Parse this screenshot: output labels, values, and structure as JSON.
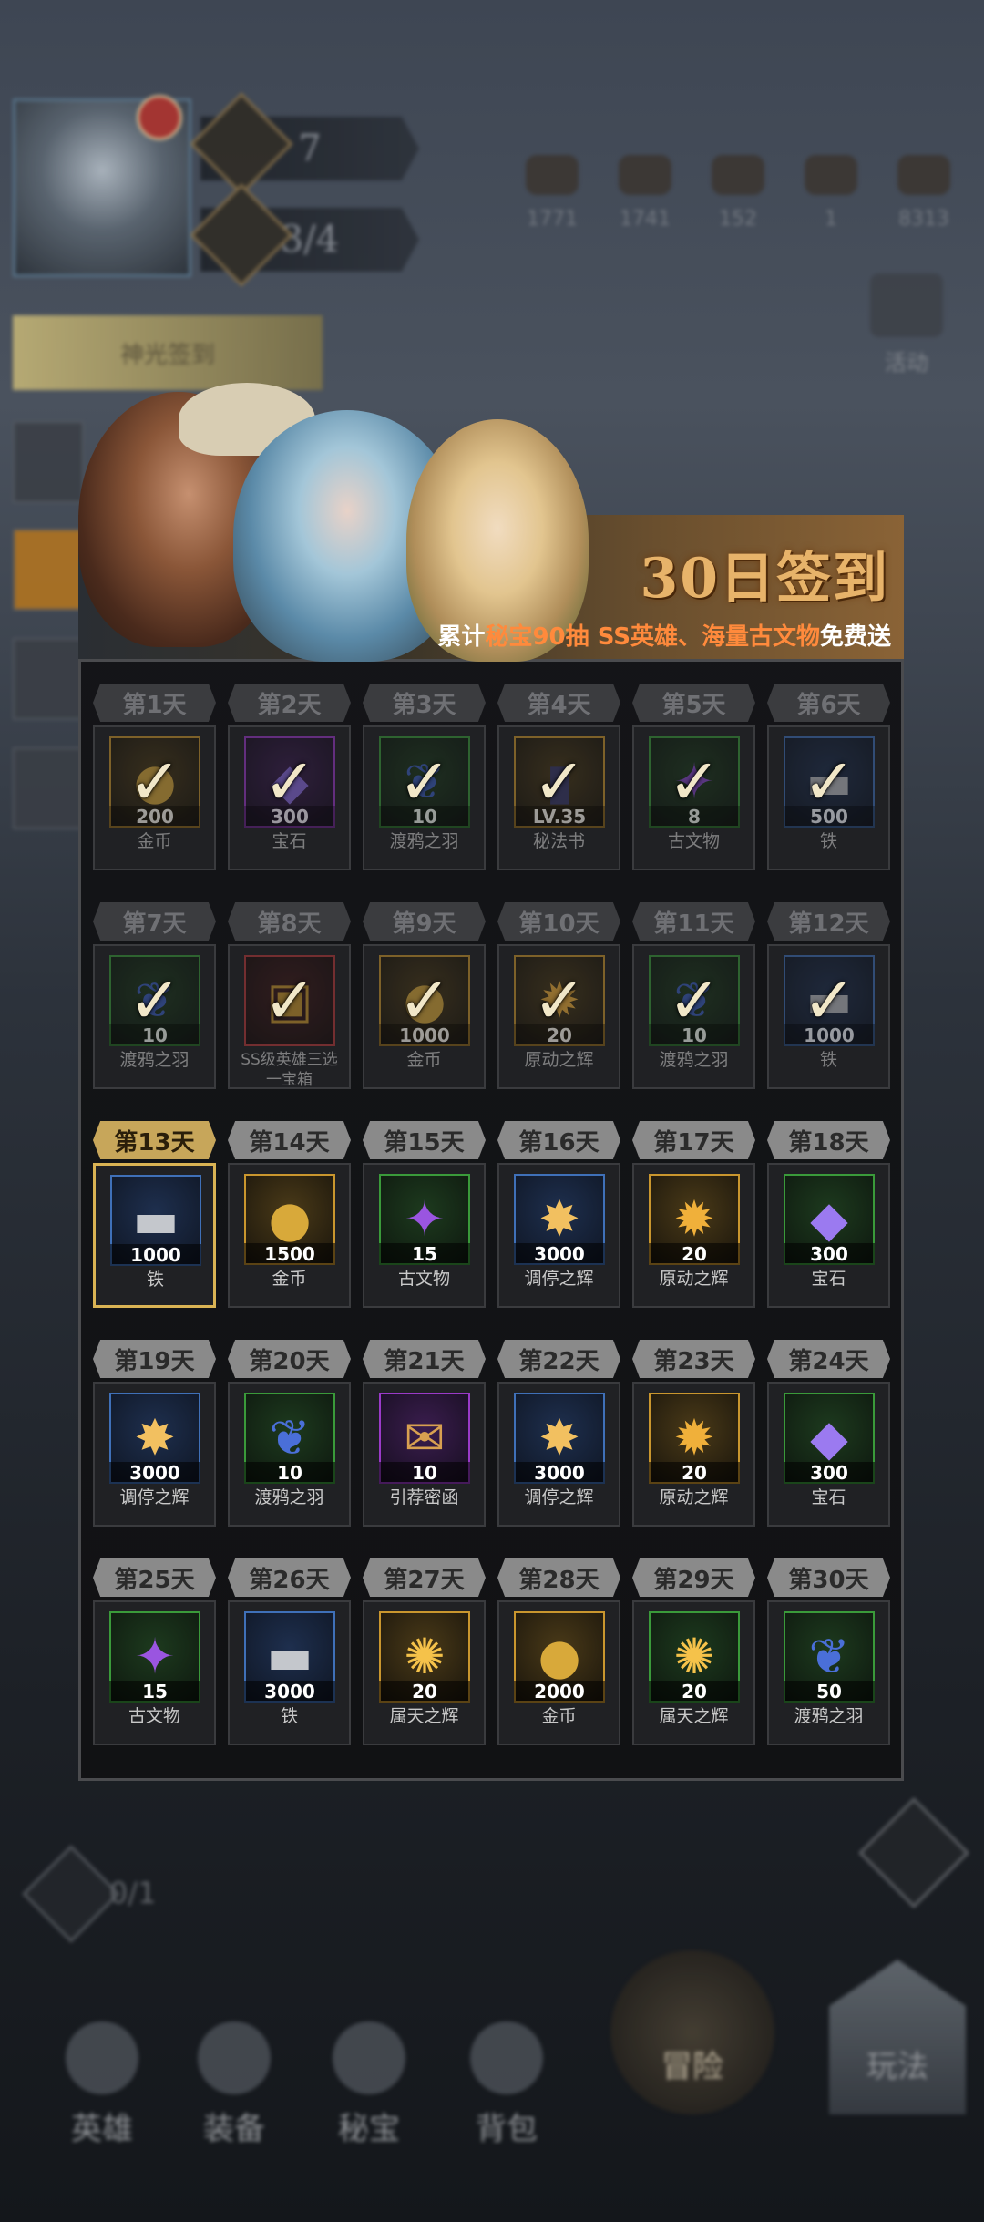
{
  "hud": {
    "level": "7",
    "progress": "3/4",
    "resources": [
      "1771",
      "1741",
      "152",
      "1",
      "8313"
    ],
    "side_banner": "神光签到",
    "right_label": "活动",
    "left_count": "0/1"
  },
  "nav": [
    "英雄",
    "装备",
    "秘宝",
    "背包",
    "冒险",
    "玩法"
  ],
  "modal": {
    "title": "30日签到",
    "subtitle_prefix": "累计",
    "subtitle_hl1": "秘宝90抽",
    "subtitle_hl2": "SS英雄、海量古文物",
    "subtitle_suffix": "免费送"
  },
  "check_mark": "✓",
  "days": [
    {
      "label": "第1天",
      "qty": "200",
      "name": "金币",
      "rarity": "gold",
      "icon": "coin-icon",
      "glyph": "●",
      "glyph_color": "#d8a93a",
      "state": "done"
    },
    {
      "label": "第2天",
      "qty": "300",
      "name": "宝石",
      "rarity": "purple",
      "icon": "gem-icon",
      "glyph": "◆",
      "glyph_color": "#8b6ae0",
      "state": "done"
    },
    {
      "label": "第3天",
      "qty": "10",
      "name": "渡鸦之羽",
      "rarity": "green",
      "icon": "raven-feather-icon",
      "glyph": "❦",
      "glyph_color": "#3d5fbf",
      "state": "done"
    },
    {
      "label": "第4天",
      "qty": "LV.35",
      "name": "秘法书",
      "rarity": "gold",
      "icon": "spellbook-icon",
      "glyph": "▮",
      "glyph_color": "#3a3a6a",
      "state": "done"
    },
    {
      "label": "第5天",
      "qty": "8",
      "name": "古文物",
      "rarity": "green",
      "icon": "relic-icon",
      "glyph": "✦",
      "glyph_color": "#8a4ad0",
      "state": "done"
    },
    {
      "label": "第6天",
      "qty": "500",
      "name": "铁",
      "rarity": "blue",
      "icon": "iron-icon",
      "glyph": "▬",
      "glyph_color": "#b9bcc2",
      "state": "done"
    },
    {
      "label": "第7天",
      "qty": "10",
      "name": "渡鸦之羽",
      "rarity": "green",
      "icon": "raven-feather-icon",
      "glyph": "❦",
      "glyph_color": "#3d5fbf",
      "state": "done"
    },
    {
      "label": "第8天",
      "qty": "",
      "name": "SS级英雄三选一宝箱",
      "rarity": "red",
      "icon": "treasure-chest-icon",
      "glyph": "▣",
      "glyph_color": "#c9962e",
      "state": "done"
    },
    {
      "label": "第9天",
      "qty": "1000",
      "name": "金币",
      "rarity": "gold",
      "icon": "coin-icon",
      "glyph": "●",
      "glyph_color": "#d8a93a",
      "state": "done"
    },
    {
      "label": "第10天",
      "qty": "20",
      "name": "原动之辉",
      "rarity": "gold",
      "icon": "prime-radiance-icon",
      "glyph": "✹",
      "glyph_color": "#f0b03a",
      "state": "done"
    },
    {
      "label": "第11天",
      "qty": "10",
      "name": "渡鸦之羽",
      "rarity": "green",
      "icon": "raven-feather-icon",
      "glyph": "❦",
      "glyph_color": "#3d5fbf",
      "state": "done"
    },
    {
      "label": "第12天",
      "qty": "1000",
      "name": "铁",
      "rarity": "blue",
      "icon": "iron-icon",
      "glyph": "▬",
      "glyph_color": "#b9bcc2",
      "state": "done"
    },
    {
      "label": "第13天",
      "qty": "1000",
      "name": "铁",
      "rarity": "blue",
      "icon": "iron-icon",
      "glyph": "▬",
      "glyph_color": "#c4c7cc",
      "state": "today"
    },
    {
      "label": "第14天",
      "qty": "1500",
      "name": "金币",
      "rarity": "gold",
      "icon": "coin-icon",
      "glyph": "●",
      "glyph_color": "#d8a93a",
      "state": "pending"
    },
    {
      "label": "第15天",
      "qty": "15",
      "name": "古文物",
      "rarity": "green",
      "icon": "relic-icon",
      "glyph": "✦",
      "glyph_color": "#9a55e0",
      "state": "pending"
    },
    {
      "label": "第16天",
      "qty": "3000",
      "name": "调停之辉",
      "rarity": "blue",
      "icon": "mediation-radiance-icon",
      "glyph": "✸",
      "glyph_color": "#f2c060",
      "state": "pending"
    },
    {
      "label": "第17天",
      "qty": "20",
      "name": "原动之辉",
      "rarity": "gold",
      "icon": "prime-radiance-icon",
      "glyph": "✹",
      "glyph_color": "#f0b03a",
      "state": "pending"
    },
    {
      "label": "第18天",
      "qty": "300",
      "name": "宝石",
      "rarity": "green",
      "icon": "gem-icon",
      "glyph": "◆",
      "glyph_color": "#9b7af0",
      "state": "pending"
    },
    {
      "label": "第19天",
      "qty": "3000",
      "name": "调停之辉",
      "rarity": "blue",
      "icon": "mediation-radiance-icon",
      "glyph": "✸",
      "glyph_color": "#f2c060",
      "state": "pending"
    },
    {
      "label": "第20天",
      "qty": "10",
      "name": "渡鸦之羽",
      "rarity": "green",
      "icon": "raven-feather-icon",
      "glyph": "❦",
      "glyph_color": "#4a6fd8",
      "state": "pending"
    },
    {
      "label": "第21天",
      "qty": "10",
      "name": "引荐密函",
      "rarity": "purple",
      "icon": "letter-scroll-icon",
      "glyph": "✉",
      "glyph_color": "#d8a050",
      "state": "pending"
    },
    {
      "label": "第22天",
      "qty": "3000",
      "name": "调停之辉",
      "rarity": "blue",
      "icon": "mediation-radiance-icon",
      "glyph": "✸",
      "glyph_color": "#f2c060",
      "state": "pending"
    },
    {
      "label": "第23天",
      "qty": "20",
      "name": "原动之辉",
      "rarity": "gold",
      "icon": "prime-radiance-icon",
      "glyph": "✹",
      "glyph_color": "#f0b03a",
      "state": "pending"
    },
    {
      "label": "第24天",
      "qty": "300",
      "name": "宝石",
      "rarity": "green",
      "icon": "gem-icon",
      "glyph": "◆",
      "glyph_color": "#9b7af0",
      "state": "pending"
    },
    {
      "label": "第25天",
      "qty": "15",
      "name": "古文物",
      "rarity": "green",
      "icon": "relic-icon",
      "glyph": "✦",
      "glyph_color": "#9a55e0",
      "state": "pending"
    },
    {
      "label": "第26天",
      "qty": "3000",
      "name": "铁",
      "rarity": "blue",
      "icon": "iron-icon",
      "glyph": "▬",
      "glyph_color": "#c4c7cc",
      "state": "pending"
    },
    {
      "label": "第27天",
      "qty": "20",
      "name": "属天之辉",
      "rarity": "gold",
      "icon": "celestial-radiance-icon",
      "glyph": "✺",
      "glyph_color": "#f5c24a",
      "state": "pending"
    },
    {
      "label": "第28天",
      "qty": "2000",
      "name": "金币",
      "rarity": "gold",
      "icon": "coin-icon",
      "glyph": "●",
      "glyph_color": "#d8a93a",
      "state": "pending"
    },
    {
      "label": "第29天",
      "qty": "20",
      "name": "属天之辉",
      "rarity": "green",
      "icon": "celestial-radiance-icon",
      "glyph": "✺",
      "glyph_color": "#f5c24a",
      "state": "pending"
    },
    {
      "label": "第30天",
      "qty": "50",
      "name": "渡鸦之羽",
      "rarity": "green",
      "icon": "raven-feather-icon",
      "glyph": "❦",
      "glyph_color": "#4a6fd8",
      "state": "pending"
    }
  ]
}
